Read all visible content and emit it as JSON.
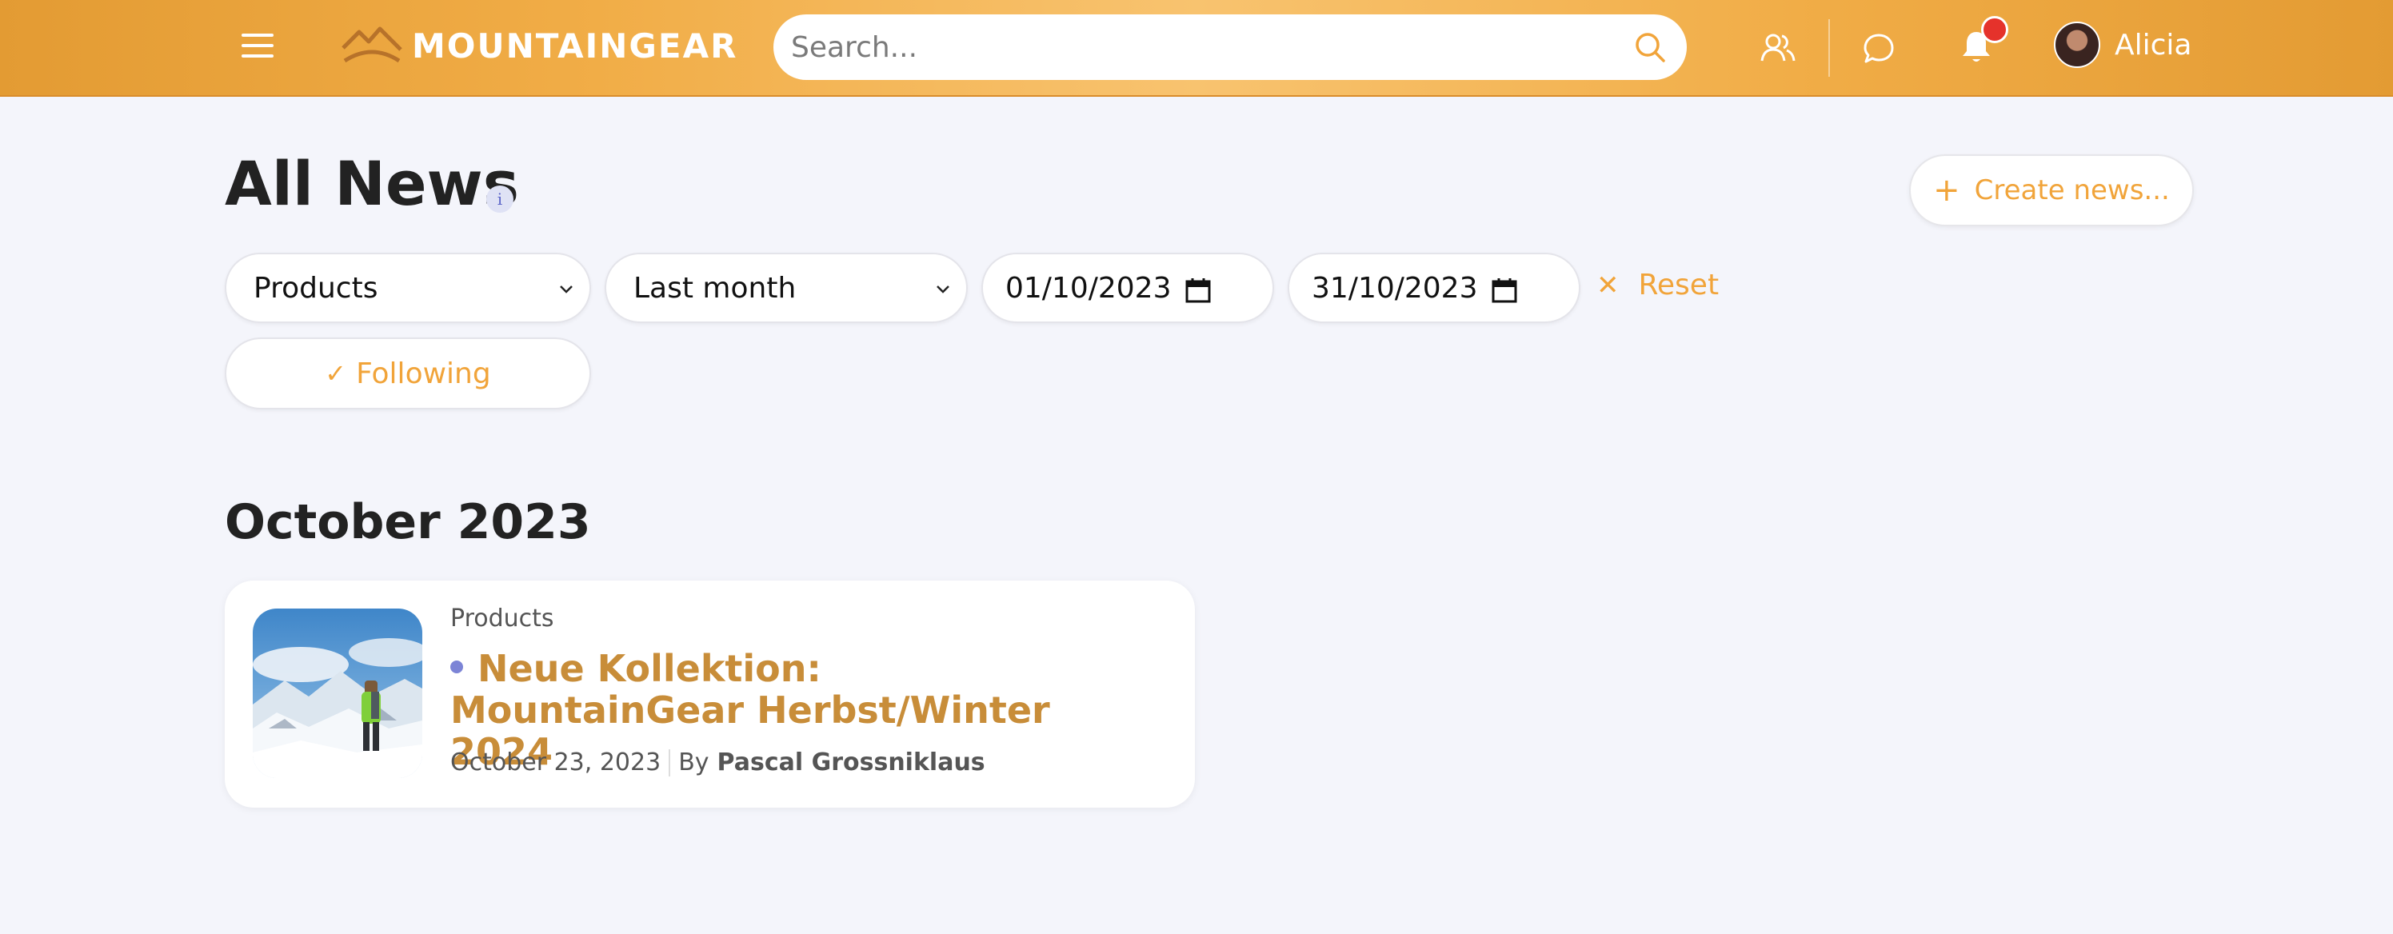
{
  "header": {
    "brand": "MOUNTAINGEAR",
    "search_placeholder": "Search...",
    "user_name": "Alicia",
    "has_notification": true,
    "accent_color": "#f1a43a"
  },
  "page": {
    "title": "All News",
    "info_label": "i",
    "create_button": "Create news..."
  },
  "filters": {
    "category": "Products",
    "period": "Last month",
    "date_from": "01/10/2023",
    "date_to": "31/10/2023",
    "reset_label": "Reset",
    "following_label": "Following"
  },
  "sections": [
    {
      "title": "October 2023",
      "items": [
        {
          "category": "Products",
          "title": "Neue Kollektion: MountainGear Herbst/Winter 2024",
          "date": "October 23, 2023",
          "by_label": "By",
          "author": "Pascal Grossniklaus"
        }
      ]
    }
  ]
}
